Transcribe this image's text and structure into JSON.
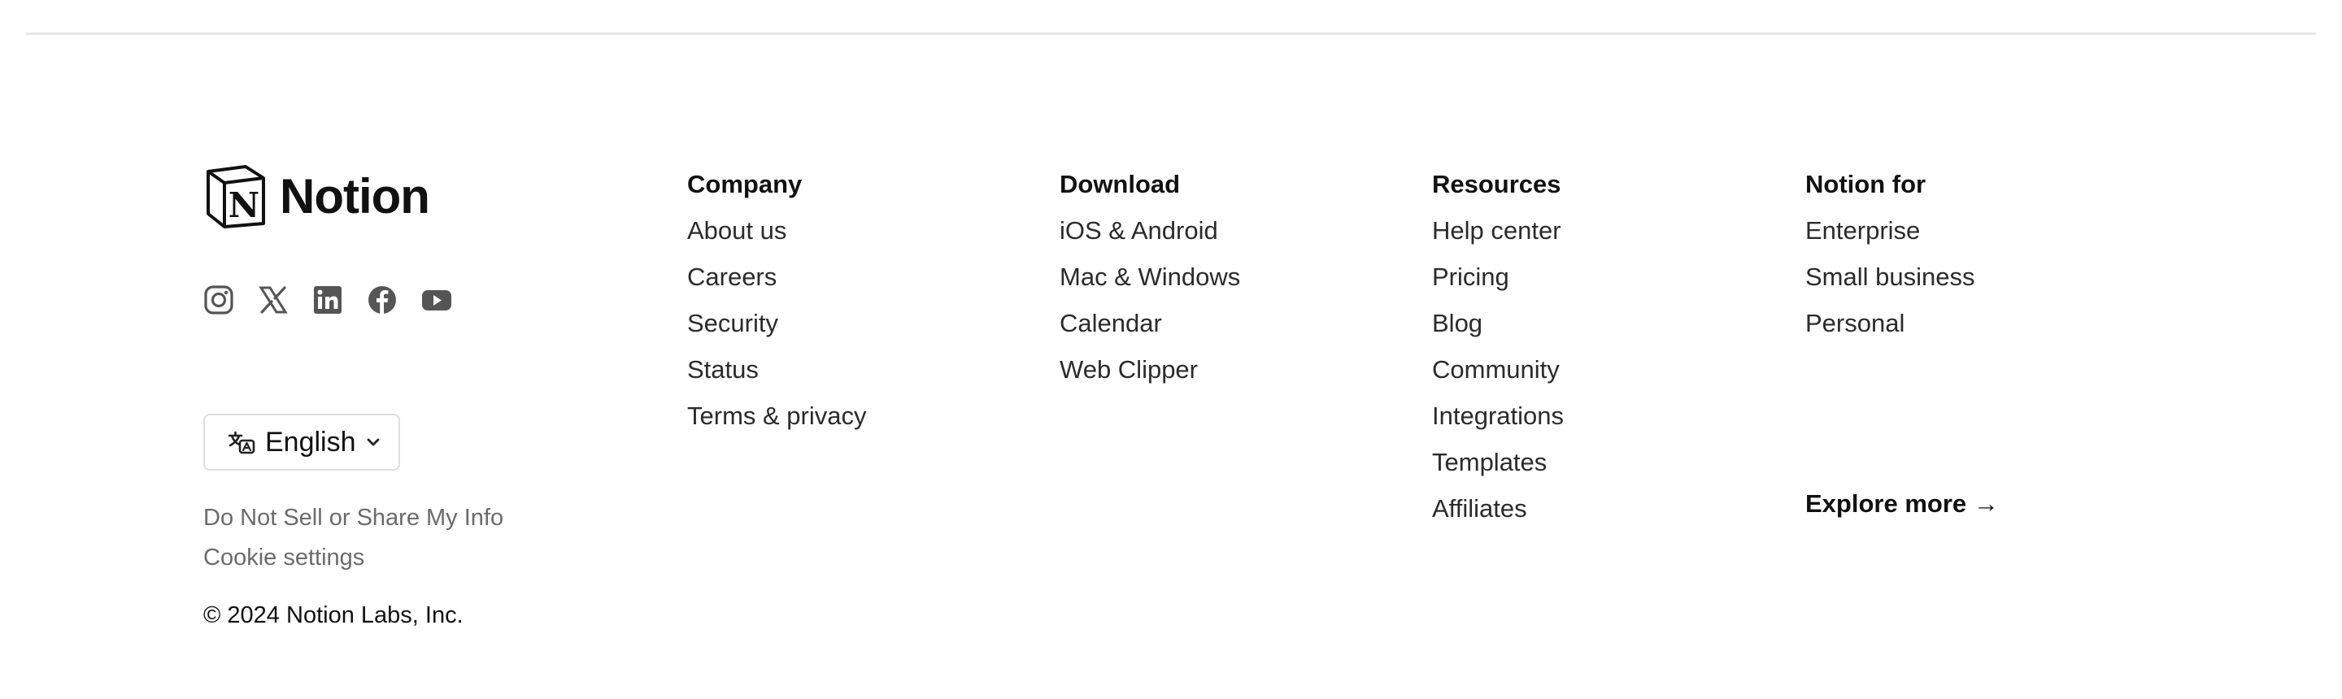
{
  "brand": {
    "name": "Notion",
    "logo_icon": "notion-cube-icon",
    "socials": [
      {
        "name": "instagram-icon"
      },
      {
        "name": "x-twitter-icon"
      },
      {
        "name": "linkedin-icon"
      },
      {
        "name": "facebook-icon"
      },
      {
        "name": "youtube-icon"
      }
    ]
  },
  "language": {
    "selected": "English",
    "icon": "translate-icon"
  },
  "legal": {
    "do_not_sell": "Do Not Sell or Share My Info",
    "cookie_settings": "Cookie settings",
    "copyright": "© 2024 Notion Labs, Inc."
  },
  "columns": [
    {
      "title": "Company",
      "links": [
        "About us",
        "Careers",
        "Security",
        "Status",
        "Terms & privacy"
      ]
    },
    {
      "title": "Download",
      "links": [
        "iOS & Android",
        "Mac & Windows",
        "Calendar",
        "Web Clipper"
      ]
    },
    {
      "title": "Resources",
      "links": [
        "Help center",
        "Pricing",
        "Blog",
        "Community",
        "Integrations",
        "Templates",
        "Affiliates"
      ]
    },
    {
      "title": "Notion for",
      "links": [
        "Enterprise",
        "Small business",
        "Personal"
      ]
    }
  ],
  "explore_more": "Explore more →",
  "colors": {
    "text": "#191919",
    "muted": "#6b6b6b",
    "divider": "#e6e6e6",
    "icon": "#555555"
  }
}
